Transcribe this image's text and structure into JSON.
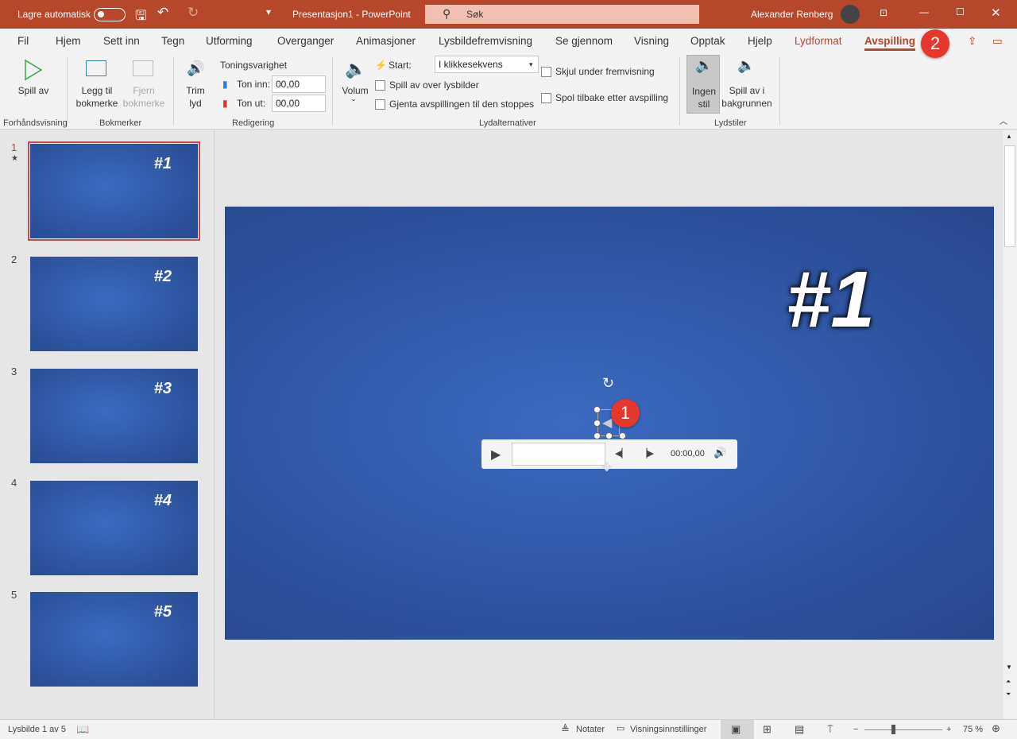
{
  "titlebar": {
    "autosave": "Lagre automatisk",
    "doc_title": "Presentasjon1  -  PowerPoint",
    "search_placeholder": "Søk",
    "user": "Alexander Renberg"
  },
  "tabs": [
    "Fil",
    "Hjem",
    "Sett inn",
    "Tegn",
    "Utforming",
    "Overganger",
    "Animasjoner",
    "Lysbildefremvisning",
    "Se gjennom",
    "Visning",
    "Opptak",
    "Hjelp",
    "Lydformat",
    "Avspilling"
  ],
  "active_tab": "Avspilling",
  "ribbon": {
    "preview": {
      "play": "Spill av",
      "group": "Forhåndsvisning"
    },
    "bookmarks": {
      "add": "Legg til bokmerke",
      "remove": "Fjern bokmerke",
      "group": "Bokmerker"
    },
    "editing": {
      "trim": "Trim lyd",
      "fade_title": "Toningsvarighet",
      "fade_in_label": "Ton inn:",
      "fade_in": "00,00",
      "fade_out_label": "Ton ut:",
      "fade_out": "00,00",
      "group": "Redigering"
    },
    "options": {
      "volume": "Volum",
      "start_label": "Start:",
      "start_value": "I klikkesekvens",
      "play_across": "Spill av over lysbilder",
      "loop": "Gjenta avspillingen til den stoppes",
      "hide": "Skjul under fremvisning",
      "rewind": "Spol tilbake etter avspilling",
      "group": "Lydalternativer"
    },
    "styles": {
      "no_style": "Ingen stil",
      "background": "Spill av i bakgrunnen",
      "group": "Lydstiler"
    }
  },
  "slides": [
    {
      "n": "1",
      "label": "#1"
    },
    {
      "n": "2",
      "label": "#2"
    },
    {
      "n": "3",
      "label": "#3"
    },
    {
      "n": "4",
      "label": "#4"
    },
    {
      "n": "5",
      "label": "#5"
    }
  ],
  "current_slide": {
    "label": "#1"
  },
  "player": {
    "time": "00:00,00"
  },
  "badges": {
    "one": "1",
    "two": "2"
  },
  "status": {
    "slide_info": "Lysbilde 1 av 5",
    "notes": "Notater",
    "view_settings": "Visningsinnstillinger",
    "zoom": "75 %"
  },
  "colors": {
    "accent": "#b7472a",
    "badge": "#e5372b",
    "slide": "#2f58a6"
  }
}
